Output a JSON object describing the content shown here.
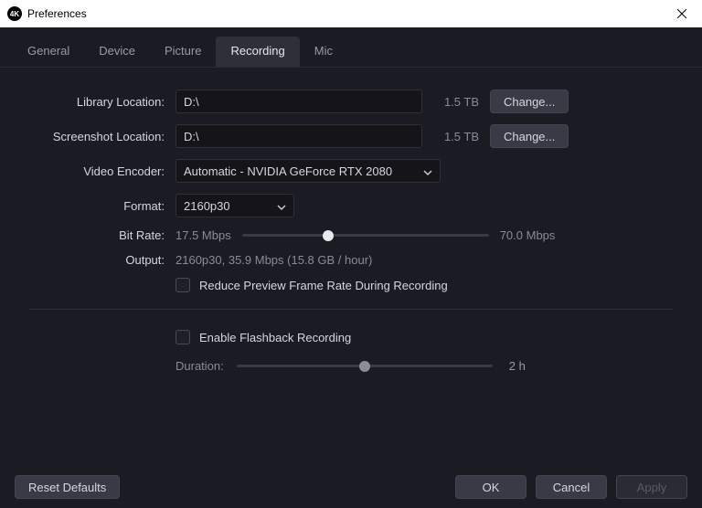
{
  "window": {
    "appicon_text": "4K",
    "title": "Preferences"
  },
  "tabs": {
    "general": "General",
    "device": "Device",
    "picture": "Picture",
    "recording": "Recording",
    "mic": "Mic",
    "active": "recording"
  },
  "recording": {
    "library_location_label": "Library Location:",
    "library_location_value": "D:\\",
    "library_size": "1.5 TB",
    "library_change": "Change...",
    "screenshot_location_label": "Screenshot Location:",
    "screenshot_location_value": "D:\\",
    "screenshot_size": "1.5 TB",
    "screenshot_change": "Change...",
    "encoder_label": "Video Encoder:",
    "encoder_value": "Automatic - NVIDIA GeForce RTX 2080",
    "format_label": "Format:",
    "format_value": "2160p30",
    "bitrate_label": "Bit Rate:",
    "bitrate_min": "17.5 Mbps",
    "bitrate_max": "70.0 Mbps",
    "bitrate_pos_pct": 35,
    "output_label": "Output:",
    "output_value": "2160p30, 35.9 Mbps (15.8 GB / hour)",
    "reduce_preview_label": "Reduce Preview Frame Rate During Recording"
  },
  "flashback": {
    "enable_label": "Enable Flashback Recording",
    "duration_label": "Duration:",
    "duration_max": "2 h",
    "duration_pos_pct": 50
  },
  "footer": {
    "reset": "Reset Defaults",
    "ok": "OK",
    "cancel": "Cancel",
    "apply": "Apply"
  }
}
